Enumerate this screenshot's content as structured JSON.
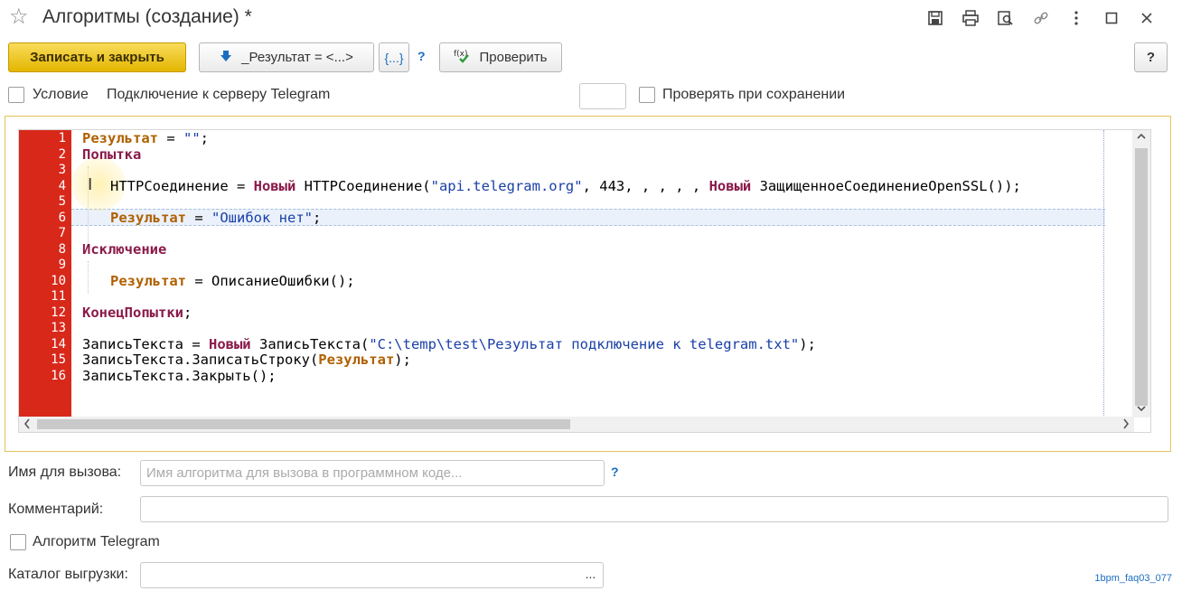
{
  "window": {
    "title": "Алгоритмы (создание) *"
  },
  "title_icons": [
    "save-icon",
    "print-icon",
    "search-doc-icon",
    "link-icon",
    "more-icon",
    "maximize-icon",
    "close-icon"
  ],
  "toolbar": {
    "save_close_label": "Записать и закрыть",
    "result_label": "_Результат = <...>",
    "braces_label": "{...}",
    "help_q": "?",
    "check_label": "Проверить",
    "help_label": "?"
  },
  "options": {
    "condition_label": "Условие",
    "telegram_connection_label": "Подключение к серверу Telegram",
    "check_on_save_label": "Проверять при сохранении"
  },
  "editor": {
    "line_numbers": [
      "1",
      "2",
      "3",
      "4",
      "5",
      "6",
      "7",
      "8",
      "9",
      "10",
      "11",
      "12",
      "13",
      "14",
      "15",
      "16"
    ]
  },
  "form": {
    "call_name_label": "Имя для вызова:",
    "call_name_placeholder": "Имя алгоритма для вызова в программном коде...",
    "call_name_help": "?",
    "comment_label": "Комментарий:",
    "telegram_algo_label": "Алгоритм Telegram",
    "export_dir_label": "Каталог выгрузки:",
    "export_dir_button": "..."
  },
  "watermark": "1bpm_faq03_077"
}
